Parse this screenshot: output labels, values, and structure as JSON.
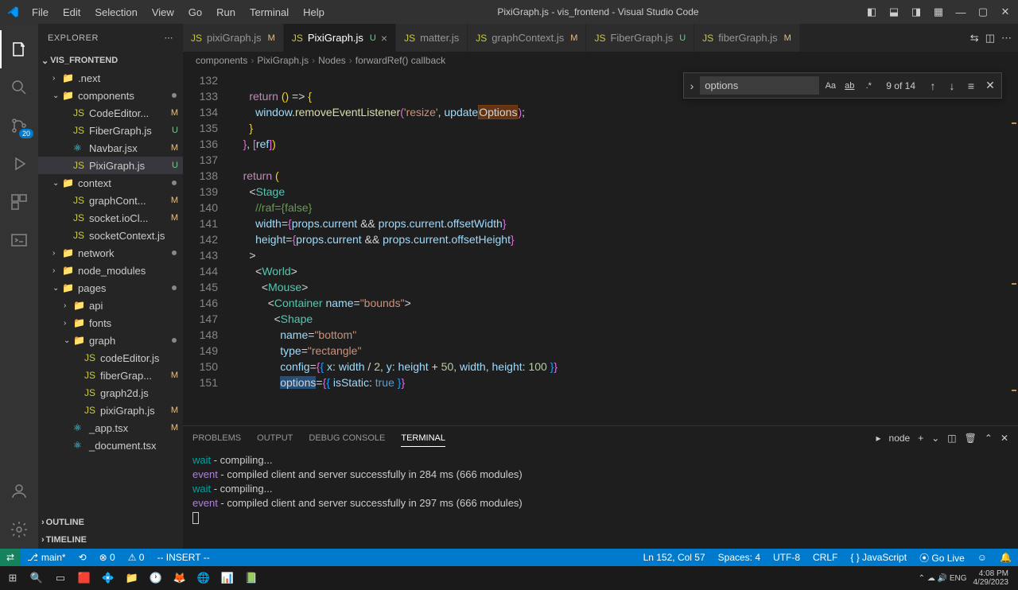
{
  "titlebar": {
    "menus": [
      "File",
      "Edit",
      "Selection",
      "View",
      "Go",
      "Run",
      "Terminal",
      "Help"
    ],
    "title": "PixiGraph.js - vis_frontend - Visual Studio Code"
  },
  "sidebar": {
    "header": "EXPLORER",
    "section": "VIS_FRONTEND",
    "tree": [
      {
        "indent": 1,
        "chev": "›",
        "icon": "📁",
        "iconClass": "folder-icon",
        "label": ".next",
        "status": "",
        "statusClass": ""
      },
      {
        "indent": 1,
        "chev": "⌄",
        "icon": "📁",
        "iconClass": "folder-icon",
        "label": "components",
        "status": "●",
        "statusClass": "dot"
      },
      {
        "indent": 2,
        "chev": "",
        "icon": "JS",
        "iconClass": "js-icon",
        "label": "CodeEditor...",
        "status": "M",
        "statusClass": "mod-m"
      },
      {
        "indent": 2,
        "chev": "",
        "icon": "JS",
        "iconClass": "js-icon",
        "label": "FiberGraph.js",
        "status": "U",
        "statusClass": "mod-u"
      },
      {
        "indent": 2,
        "chev": "",
        "icon": "⚛",
        "iconClass": "react-icon",
        "label": "Navbar.jsx",
        "status": "M",
        "statusClass": "mod-m"
      },
      {
        "indent": 2,
        "chev": "",
        "icon": "JS",
        "iconClass": "js-icon",
        "label": "PixiGraph.js",
        "status": "U",
        "statusClass": "mod-u",
        "active": true
      },
      {
        "indent": 1,
        "chev": "⌄",
        "icon": "📁",
        "iconClass": "folder-icon",
        "label": "context",
        "status": "●",
        "statusClass": "dot"
      },
      {
        "indent": 2,
        "chev": "",
        "icon": "JS",
        "iconClass": "js-icon",
        "label": "graphCont...",
        "status": "M",
        "statusClass": "mod-m"
      },
      {
        "indent": 2,
        "chev": "",
        "icon": "JS",
        "iconClass": "js-icon",
        "label": "socket.ioCl...",
        "status": "M",
        "statusClass": "mod-m"
      },
      {
        "indent": 2,
        "chev": "",
        "icon": "JS",
        "iconClass": "js-icon",
        "label": "socketContext.js",
        "status": "",
        "statusClass": ""
      },
      {
        "indent": 1,
        "chev": "›",
        "icon": "📁",
        "iconClass": "folder-icon",
        "label": "network",
        "status": "●",
        "statusClass": "dot"
      },
      {
        "indent": 1,
        "chev": "›",
        "icon": "📁",
        "iconClass": "folder-icon",
        "label": "node_modules",
        "status": "",
        "statusClass": ""
      },
      {
        "indent": 1,
        "chev": "⌄",
        "icon": "📁",
        "iconClass": "folder-icon",
        "label": "pages",
        "status": "●",
        "statusClass": "dot"
      },
      {
        "indent": 2,
        "chev": "›",
        "icon": "📁",
        "iconClass": "folder-icon",
        "label": "api",
        "status": "",
        "statusClass": ""
      },
      {
        "indent": 2,
        "chev": "›",
        "icon": "📁",
        "iconClass": "folder-icon",
        "label": "fonts",
        "status": "",
        "statusClass": ""
      },
      {
        "indent": 2,
        "chev": "⌄",
        "icon": "📁",
        "iconClass": "folder-icon",
        "label": "graph",
        "status": "●",
        "statusClass": "dot"
      },
      {
        "indent": 3,
        "chev": "",
        "icon": "JS",
        "iconClass": "js-icon",
        "label": "codeEditor.js",
        "status": "",
        "statusClass": ""
      },
      {
        "indent": 3,
        "chev": "",
        "icon": "JS",
        "iconClass": "js-icon",
        "label": "fiberGrap...",
        "status": "M",
        "statusClass": "mod-m"
      },
      {
        "indent": 3,
        "chev": "",
        "icon": "JS",
        "iconClass": "js-icon",
        "label": "graph2d.js",
        "status": "",
        "statusClass": ""
      },
      {
        "indent": 3,
        "chev": "",
        "icon": "JS",
        "iconClass": "js-icon",
        "label": "pixiGraph.js",
        "status": "M",
        "statusClass": "mod-m"
      },
      {
        "indent": 2,
        "chev": "",
        "icon": "⚛",
        "iconClass": "react-icon",
        "label": "_app.tsx",
        "status": "M",
        "statusClass": "mod-m"
      },
      {
        "indent": 2,
        "chev": "",
        "icon": "⚛",
        "iconClass": "react-icon",
        "label": "_document.tsx",
        "status": "",
        "statusClass": ""
      }
    ],
    "outline": "OUTLINE",
    "timeline": "TIMELINE"
  },
  "tabs": [
    {
      "icon": "JS",
      "iconClass": "js-icon",
      "label": "pixiGraph.js",
      "mod": "M",
      "modClass": "mod-m",
      "active": false
    },
    {
      "icon": "JS",
      "iconClass": "js-icon",
      "label": "PixiGraph.js",
      "mod": "U",
      "modClass": "mod-u",
      "active": true,
      "close": true
    },
    {
      "icon": "JS",
      "iconClass": "js-icon",
      "label": "matter.js",
      "mod": "",
      "modClass": "",
      "active": false
    },
    {
      "icon": "JS",
      "iconClass": "js-icon",
      "label": "graphContext.js",
      "mod": "M",
      "modClass": "mod-m",
      "active": false
    },
    {
      "icon": "JS",
      "iconClass": "js-icon",
      "label": "FiberGraph.js",
      "mod": "U",
      "modClass": "mod-u",
      "active": false
    },
    {
      "icon": "JS",
      "iconClass": "js-icon",
      "label": "fiberGraph.js",
      "mod": "M",
      "modClass": "mod-m",
      "active": false
    }
  ],
  "breadcrumb": [
    "components",
    "PixiGraph.js",
    "Nodes",
    "forwardRef() callback"
  ],
  "find": {
    "value": "options",
    "counter": "9 of 14"
  },
  "code": {
    "startLine": 132,
    "lines": [
      "",
      "      <span class='tk-keyword'>return</span> <span class='tk-brace'>()</span> <span class='tk-punct'>=&gt;</span> <span class='tk-brace'>{</span>",
      "        <span class='tk-var'>window</span>.<span class='tk-func'>removeEventListener</span><span class='tk-brace2'>(</span><span class='tk-string'>'resize'</span>, <span class='tk-var'>update</span><span class='hl-search'>Options</span><span class='tk-brace2'>)</span>;",
      "      <span class='tk-brace'>}</span>",
      "    <span class='tk-brace2'>}</span>, <span class='tk-brace2'>[</span><span class='tk-var'>ref</span><span class='tk-brace2'>]</span><span class='tk-brace'>)</span>",
      "",
      "    <span class='tk-keyword'>return</span> <span class='tk-brace'>(</span>",
      "      <span class='tk-punct'>&lt;</span><span class='tk-tag'>Stage</span>",
      "        <span class='tk-comment'>//raf={false}</span>",
      "        <span class='tk-attr'>width</span>=<span class='tk-brace2'>{</span><span class='tk-var'>props</span>.<span class='tk-var'>current</span> <span class='tk-punct'>&amp;&amp;</span> <span class='tk-var'>props</span>.<span class='tk-var'>current</span>.<span class='tk-var'>offsetWidth</span><span class='tk-brace2'>}</span>",
      "        <span class='tk-attr'>height</span>=<span class='tk-brace2'>{</span><span class='tk-var'>props</span>.<span class='tk-var'>current</span> <span class='tk-punct'>&amp;&amp;</span> <span class='tk-var'>props</span>.<span class='tk-var'>current</span>.<span class='tk-var'>offsetHeight</span><span class='tk-brace2'>}</span>",
      "      <span class='tk-punct'>&gt;</span>",
      "        <span class='tk-punct'>&lt;</span><span class='tk-tag'>World</span><span class='tk-punct'>&gt;</span>",
      "          <span class='tk-punct'>&lt;</span><span class='tk-tag'>Mouse</span><span class='tk-punct'>&gt;</span>",
      "            <span class='tk-punct'>&lt;</span><span class='tk-tag'>Container</span> <span class='tk-attr'>name</span>=<span class='tk-string'>\"bounds\"</span><span class='tk-punct'>&gt;</span>",
      "              <span class='tk-punct'>&lt;</span><span class='tk-tag'>Shape</span>",
      "                <span class='tk-attr'>name</span>=<span class='tk-string'>\"bottom\"</span>",
      "                <span class='tk-attr'>type</span>=<span class='tk-string'>\"rectangle\"</span>",
      "                <span class='tk-attr'>config</span>=<span class='tk-brace2'>{</span><span class='tk-brace3'>{</span> <span class='tk-var'>x</span>: <span class='tk-var'>width</span> / <span class='tk-number'>2</span>, <span class='tk-var'>y</span>: <span class='tk-var'>height</span> + <span class='tk-number'>50</span>, <span class='tk-var'>width</span>, <span class='tk-var'>height</span>: <span class='tk-number'>100</span> <span class='tk-brace3'>}</span><span class='tk-brace2'>}</span>",
      "                <span class='hl-sel'>options</span>=<span class='tk-brace2'>{</span><span class='tk-brace3'>{</span> <span class='tk-var'>isStatic</span>: <span class='tk-bool'>true</span> <span class='tk-brace3'>}</span><span class='tk-brace2'>}</span>"
    ]
  },
  "panel": {
    "tabs": [
      "PROBLEMS",
      "OUTPUT",
      "DEBUG CONSOLE",
      "TERMINAL"
    ],
    "activeTab": 3,
    "shell": "node",
    "lines": [
      {
        "prefix": "wait",
        "prefixClass": "term-wait",
        "text": "  - compiling..."
      },
      {
        "prefix": "event",
        "prefixClass": "term-event",
        "text": " - compiled client and server successfully in 284 ms (666 modules)"
      },
      {
        "prefix": "wait",
        "prefixClass": "term-wait",
        "text": "  - compiling..."
      },
      {
        "prefix": "event",
        "prefixClass": "term-event",
        "text": " - compiled client and server successfully in 297 ms (666 modules)"
      }
    ]
  },
  "statusbar": {
    "branch": "main*",
    "sync": "⟲",
    "errors": "⊗ 0",
    "warnings": "⚠ 0",
    "mode": "-- INSERT --",
    "cursor": "Ln 152, Col 57",
    "spaces": "Spaces: 4",
    "encoding": "UTF-8",
    "eol": "CRLF",
    "lang": "{ } JavaScript",
    "golive": "⦿ Go Live",
    "bell": "🔔"
  },
  "scm_badge": "20",
  "taskbar": {
    "time": "4:08 PM",
    "date": "4/29/2023"
  }
}
